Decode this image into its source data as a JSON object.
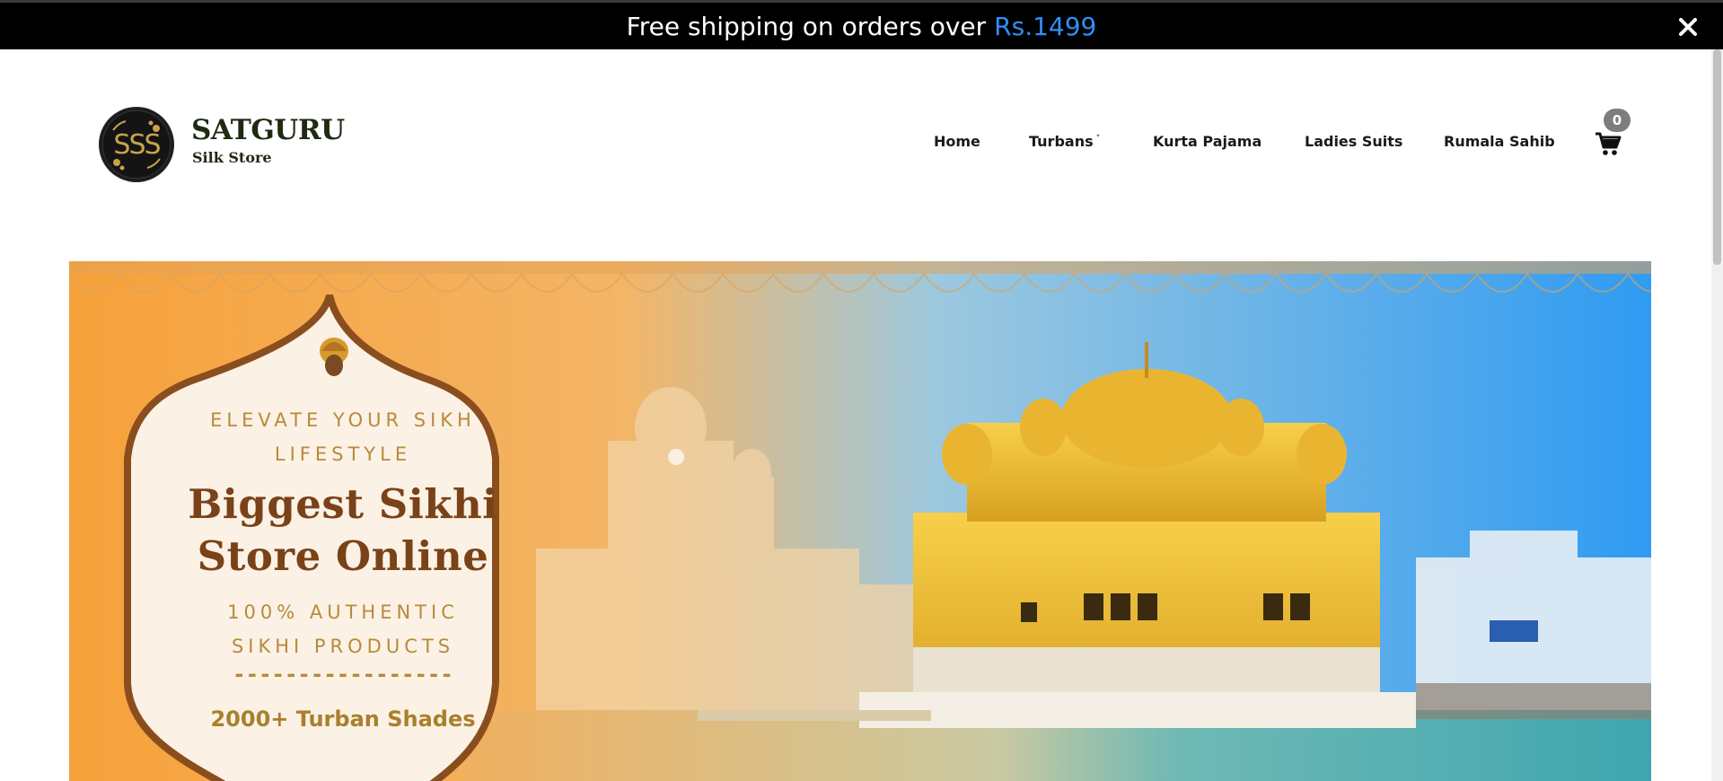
{
  "announcement": {
    "text": "Free shipping on orders over",
    "price": "Rs.1499",
    "close_icon": "close-icon"
  },
  "brand": {
    "logo_text": "SSS",
    "title": "SATGURU",
    "subtitle": "Silk Store"
  },
  "nav": {
    "items": [
      {
        "label": "Home"
      },
      {
        "label": "Turbans",
        "has_dropdown": true,
        "caret": "˅"
      },
      {
        "label": "Kurta Pajama"
      },
      {
        "label": "Ladies Suits"
      },
      {
        "label": "Rumala Sahib"
      }
    ],
    "cart_icon": "cart-icon",
    "cart_count": "0"
  },
  "hero": {
    "kicker_line1": "ELEVATE YOUR SIKH",
    "kicker_line2": "LIFESTYLE",
    "headline_line1": "Biggest Sikhi",
    "headline_line2": "Store Online",
    "sub_line1": "100% AUTHENTIC",
    "sub_line2": "SIKHI PRODUCTS",
    "divider": "-----------------",
    "shades": "2000+ Turban Shades"
  },
  "colors": {
    "announcement_bg": "#000000",
    "price_accent": "#2f8ff5",
    "hero_orange": "#f6a13a",
    "hero_sky": "#2f9bf2",
    "panel_border": "#8a4e1e",
    "headline_brown": "#7a4218",
    "gold": "#d9a52c"
  }
}
